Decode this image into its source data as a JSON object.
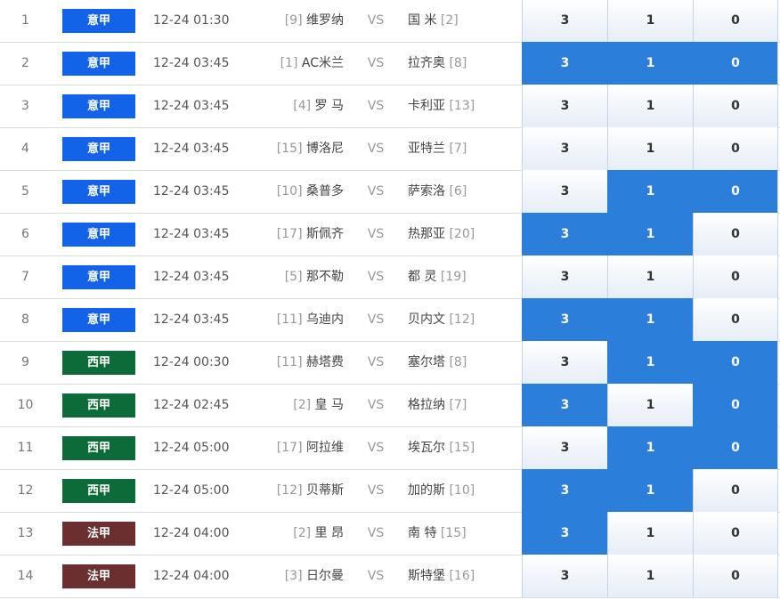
{
  "colors": {
    "serie_a": "#1363e8",
    "la_liga": "#0d6b3a",
    "ligue_1": "#6b2f2f",
    "selected": "#2b7fdb"
  },
  "vs_label": "VS",
  "matches": [
    {
      "index": "1",
      "league": "意甲",
      "league_key": "serie_a",
      "time": "12-24 01:30",
      "home_rank": "[9]",
      "home": "维罗纳",
      "away": "国 米",
      "away_rank": "[2]",
      "options": [
        "3",
        "1",
        "0"
      ],
      "selected": [
        false,
        false,
        false
      ]
    },
    {
      "index": "2",
      "league": "意甲",
      "league_key": "serie_a",
      "time": "12-24 03:45",
      "home_rank": "[1]",
      "home": "AC米兰",
      "away": "拉齐奥",
      "away_rank": "[8]",
      "options": [
        "3",
        "1",
        "0"
      ],
      "selected": [
        true,
        true,
        true
      ]
    },
    {
      "index": "3",
      "league": "意甲",
      "league_key": "serie_a",
      "time": "12-24 03:45",
      "home_rank": "[4]",
      "home": "罗 马",
      "away": "卡利亚",
      "away_rank": "[13]",
      "options": [
        "3",
        "1",
        "0"
      ],
      "selected": [
        false,
        false,
        false
      ]
    },
    {
      "index": "4",
      "league": "意甲",
      "league_key": "serie_a",
      "time": "12-24 03:45",
      "home_rank": "[15]",
      "home": "博洛尼",
      "away": "亚特兰",
      "away_rank": "[7]",
      "options": [
        "3",
        "1",
        "0"
      ],
      "selected": [
        false,
        false,
        false
      ]
    },
    {
      "index": "5",
      "league": "意甲",
      "league_key": "serie_a",
      "time": "12-24 03:45",
      "home_rank": "[10]",
      "home": "桑普多",
      "away": "萨索洛",
      "away_rank": "[6]",
      "options": [
        "3",
        "1",
        "0"
      ],
      "selected": [
        false,
        true,
        true
      ]
    },
    {
      "index": "6",
      "league": "意甲",
      "league_key": "serie_a",
      "time": "12-24 03:45",
      "home_rank": "[17]",
      "home": "斯佩齐",
      "away": "热那亚",
      "away_rank": "[20]",
      "options": [
        "3",
        "1",
        "0"
      ],
      "selected": [
        true,
        true,
        false
      ]
    },
    {
      "index": "7",
      "league": "意甲",
      "league_key": "serie_a",
      "time": "12-24 03:45",
      "home_rank": "[5]",
      "home": "那不勒",
      "away": "都 灵",
      "away_rank": "[19]",
      "options": [
        "3",
        "1",
        "0"
      ],
      "selected": [
        false,
        false,
        false
      ]
    },
    {
      "index": "8",
      "league": "意甲",
      "league_key": "serie_a",
      "time": "12-24 03:45",
      "home_rank": "[11]",
      "home": "乌迪内",
      "away": "贝内文",
      "away_rank": "[12]",
      "options": [
        "3",
        "1",
        "0"
      ],
      "selected": [
        true,
        true,
        false
      ]
    },
    {
      "index": "9",
      "league": "西甲",
      "league_key": "la_liga",
      "time": "12-24 00:30",
      "home_rank": "[11]",
      "home": "赫塔费",
      "away": "塞尔塔",
      "away_rank": "[8]",
      "options": [
        "3",
        "1",
        "0"
      ],
      "selected": [
        false,
        true,
        true
      ]
    },
    {
      "index": "10",
      "league": "西甲",
      "league_key": "la_liga",
      "time": "12-24 02:45",
      "home_rank": "[2]",
      "home": "皇 马",
      "away": "格拉纳",
      "away_rank": "[7]",
      "options": [
        "3",
        "1",
        "0"
      ],
      "selected": [
        true,
        false,
        true
      ]
    },
    {
      "index": "11",
      "league": "西甲",
      "league_key": "la_liga",
      "time": "12-24 05:00",
      "home_rank": "[17]",
      "home": "阿拉维",
      "away": "埃瓦尔",
      "away_rank": "[15]",
      "options": [
        "3",
        "1",
        "0"
      ],
      "selected": [
        false,
        true,
        true
      ]
    },
    {
      "index": "12",
      "league": "西甲",
      "league_key": "la_liga",
      "time": "12-24 05:00",
      "home_rank": "[12]",
      "home": "贝蒂斯",
      "away": "加的斯",
      "away_rank": "[10]",
      "options": [
        "3",
        "1",
        "0"
      ],
      "selected": [
        true,
        true,
        false
      ]
    },
    {
      "index": "13",
      "league": "法甲",
      "league_key": "ligue_1",
      "time": "12-24 04:00",
      "home_rank": "[2]",
      "home": "里 昂",
      "away": "南 特",
      "away_rank": "[15]",
      "options": [
        "3",
        "1",
        "0"
      ],
      "selected": [
        true,
        false,
        false
      ]
    },
    {
      "index": "14",
      "league": "法甲",
      "league_key": "ligue_1",
      "time": "12-24 04:00",
      "home_rank": "[3]",
      "home": "日尔曼",
      "away": "斯特堡",
      "away_rank": "[16]",
      "options": [
        "3",
        "1",
        "0"
      ],
      "selected": [
        false,
        false,
        false
      ]
    }
  ]
}
